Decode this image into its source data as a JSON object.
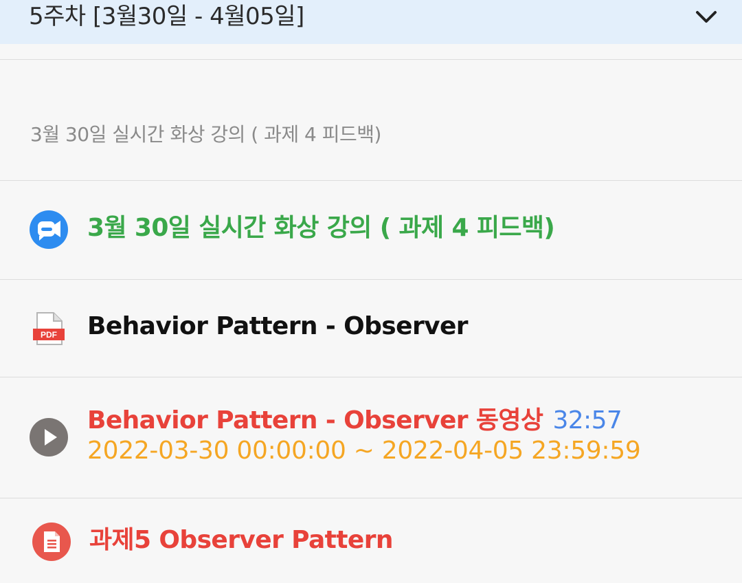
{
  "week": {
    "title": "5주차 [3월30일 - 4월05일]",
    "toggle_icon": "chevron-down-icon"
  },
  "section": {
    "label": "3월 30일 실시간 화상 강의 ( 과제 4 피드백)"
  },
  "items": [
    {
      "type": "video-conference",
      "icon": "video-conference-icon",
      "title": "3월 30일 실시간 화상 강의 ( 과제 4 피드백)",
      "color": "#3aa84a"
    },
    {
      "type": "pdf",
      "icon": "pdf-file-icon",
      "icon_label": "PDF",
      "title": "Behavior Pattern - Observer",
      "color": "#111111"
    },
    {
      "type": "video",
      "icon": "play-icon",
      "title": "Behavior Pattern - Observer 동영상",
      "duration": "32:57",
      "date_range": "2022-03-30 00:00:00 ~ 2022-04-05 23:59:59",
      "color": "#e8423a",
      "duration_color": "#4a86e8",
      "date_color": "#f5a623"
    },
    {
      "type": "assignment",
      "icon": "assignment-icon",
      "title": "과제5 Observer Pattern",
      "color": "#e8423a"
    }
  ]
}
